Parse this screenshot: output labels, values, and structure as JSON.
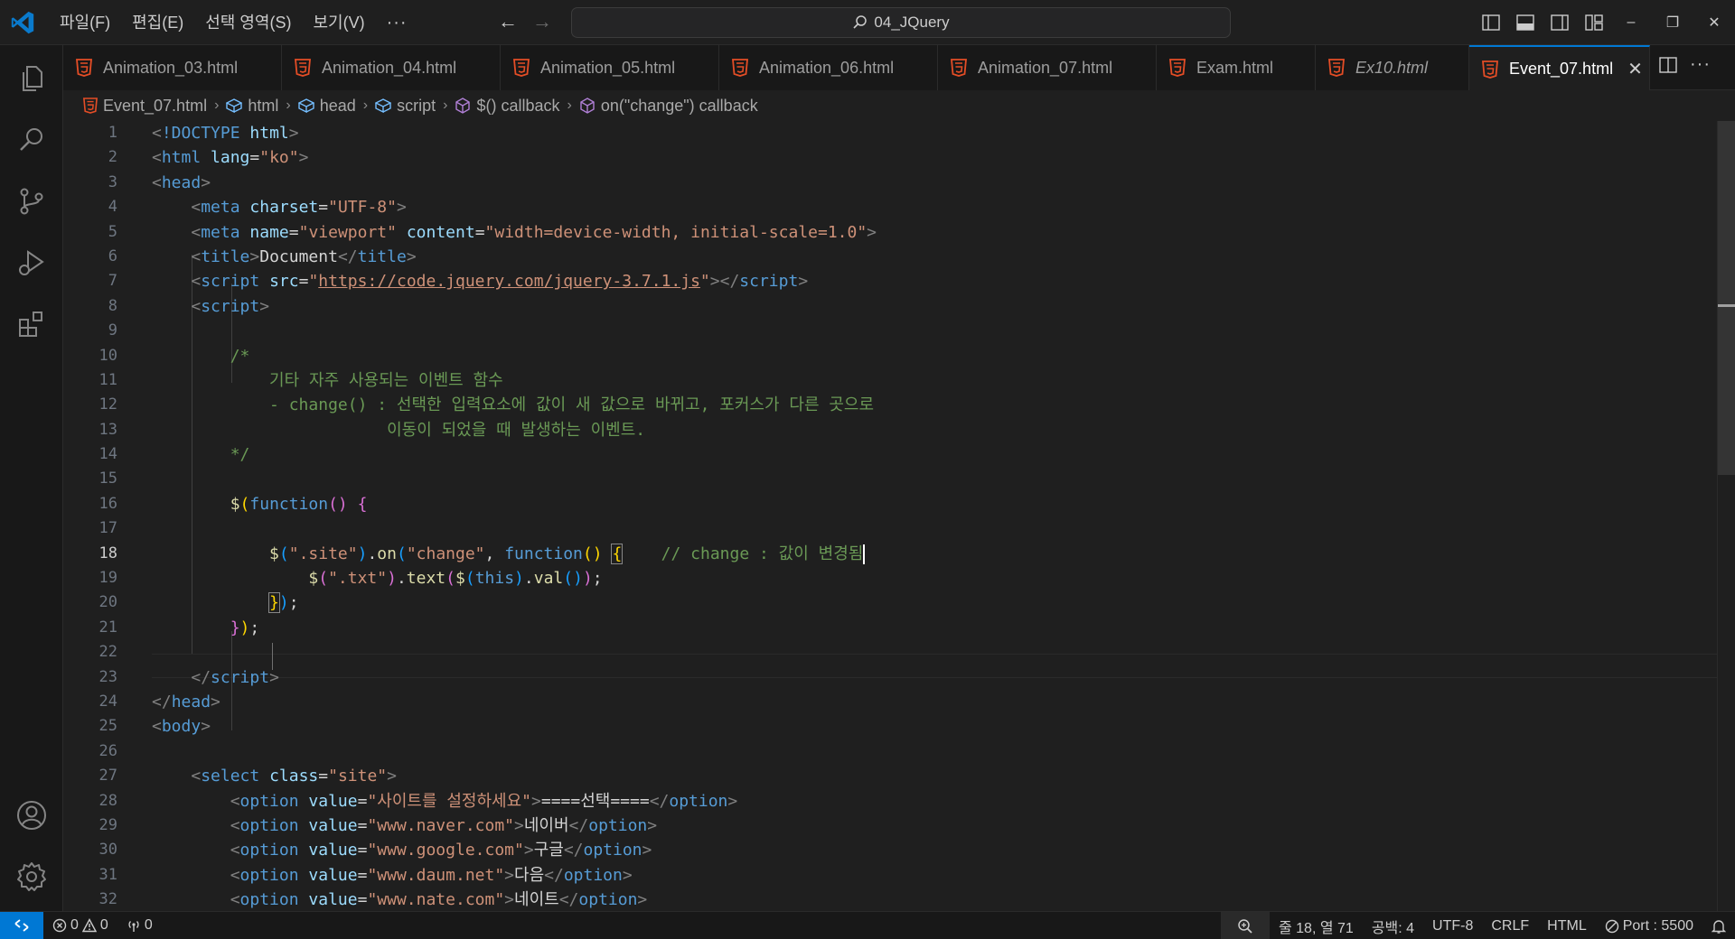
{
  "titlebar": {
    "menus": [
      "파일(F)",
      "편집(E)",
      "선택 영역(S)",
      "보기(V)"
    ],
    "more": "···",
    "search": "04_JQuery"
  },
  "tabs": [
    {
      "label": "Animation_03.html",
      "italic": false,
      "active": false
    },
    {
      "label": "Animation_04.html",
      "italic": false,
      "active": false
    },
    {
      "label": "Animation_05.html",
      "italic": false,
      "active": false
    },
    {
      "label": "Animation_06.html",
      "italic": false,
      "active": false
    },
    {
      "label": "Animation_07.html",
      "italic": false,
      "active": false
    },
    {
      "label": "Exam.html",
      "italic": false,
      "active": false
    },
    {
      "label": "Ex10.html",
      "italic": true,
      "active": false
    },
    {
      "label": "Event_07.html",
      "italic": false,
      "active": true
    }
  ],
  "breadcrumb": [
    "Event_07.html",
    "html",
    "head",
    "script",
    "$() callback",
    "on(\"change\") callback"
  ],
  "editor": {
    "current_line": 18,
    "line_numbers": [
      "1",
      "2",
      "3",
      "4",
      "5",
      "6",
      "7",
      "8",
      "9",
      "10",
      "11",
      "12",
      "13",
      "14",
      "15",
      "16",
      "17",
      "18",
      "19",
      "20",
      "21",
      "22",
      "23",
      "24",
      "25",
      "26",
      "27",
      "28",
      "29",
      "30",
      "31",
      "32"
    ],
    "doctype": "!DOCTYPE",
    "html_lang": "\"ko\"",
    "meta_charset": "\"UTF-8\"",
    "meta_viewport_name": "\"viewport\"",
    "meta_viewport_content": "\"width=device-width, initial-scale=1.0\"",
    "title_text": "Document",
    "script_src": "https://code.jquery.com/jquery-3.7.1.js",
    "comment_open": "/*",
    "comment_line_1": "기타 자주 사용되는 이벤트 함수",
    "comment_line_2": "- change() : 선택한 입력요소에 값이 새 값으로 바뀌고, 포커스가 다른 곳으로",
    "comment_line_3": "이동이 되었을 때 발생하는 이벤트.",
    "comment_close": "*/",
    "selector_site": "\".site\"",
    "event_name": "\"change\"",
    "inline_comment": "// change : 값이 변경됨",
    "selector_txt": "\".txt\"",
    "select_class": "\"site\"",
    "options": [
      {
        "value": "\"사이트를 설정하세요\"",
        "text": "====선택===="
      },
      {
        "value": "\"www.naver.com\"",
        "text": "네이버"
      },
      {
        "value": "\"www.google.com\"",
        "text": "구글"
      },
      {
        "value": "\"www.daum.net\"",
        "text": "다음"
      },
      {
        "value": "\"www.nate.com\"",
        "text": "네이트"
      }
    ]
  },
  "statusbar": {
    "errors": "0",
    "warnings": "0",
    "ports": "0",
    "cursor_position": "줄 18, 열 71",
    "indent": "공백: 4",
    "encoding": "UTF-8",
    "eol": "CRLF",
    "language": "HTML",
    "live_server": "Port : 5500"
  },
  "colors": {
    "accent": "#0078d4",
    "html5_icon": "#e44d26",
    "background": "#1f1f1f"
  }
}
